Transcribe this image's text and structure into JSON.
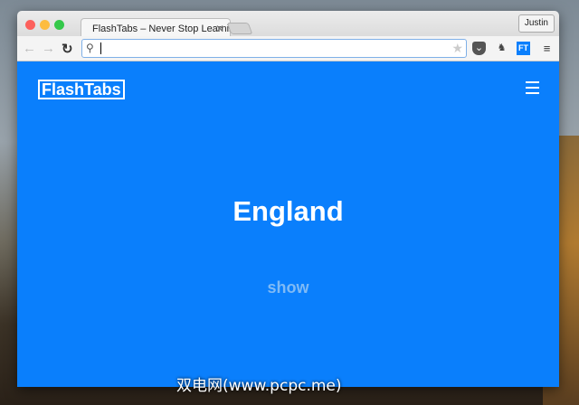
{
  "browser": {
    "tab_title": "FlashTabs – Never Stop Learning",
    "user": "Justin",
    "address": "",
    "ext_ft": "FT"
  },
  "page": {
    "logo": "FlashTabs",
    "word": "England",
    "show_label": "show"
  },
  "watermark": "双电网(www.pcpc.me)",
  "colors": {
    "accent": "#0a7ffc"
  }
}
